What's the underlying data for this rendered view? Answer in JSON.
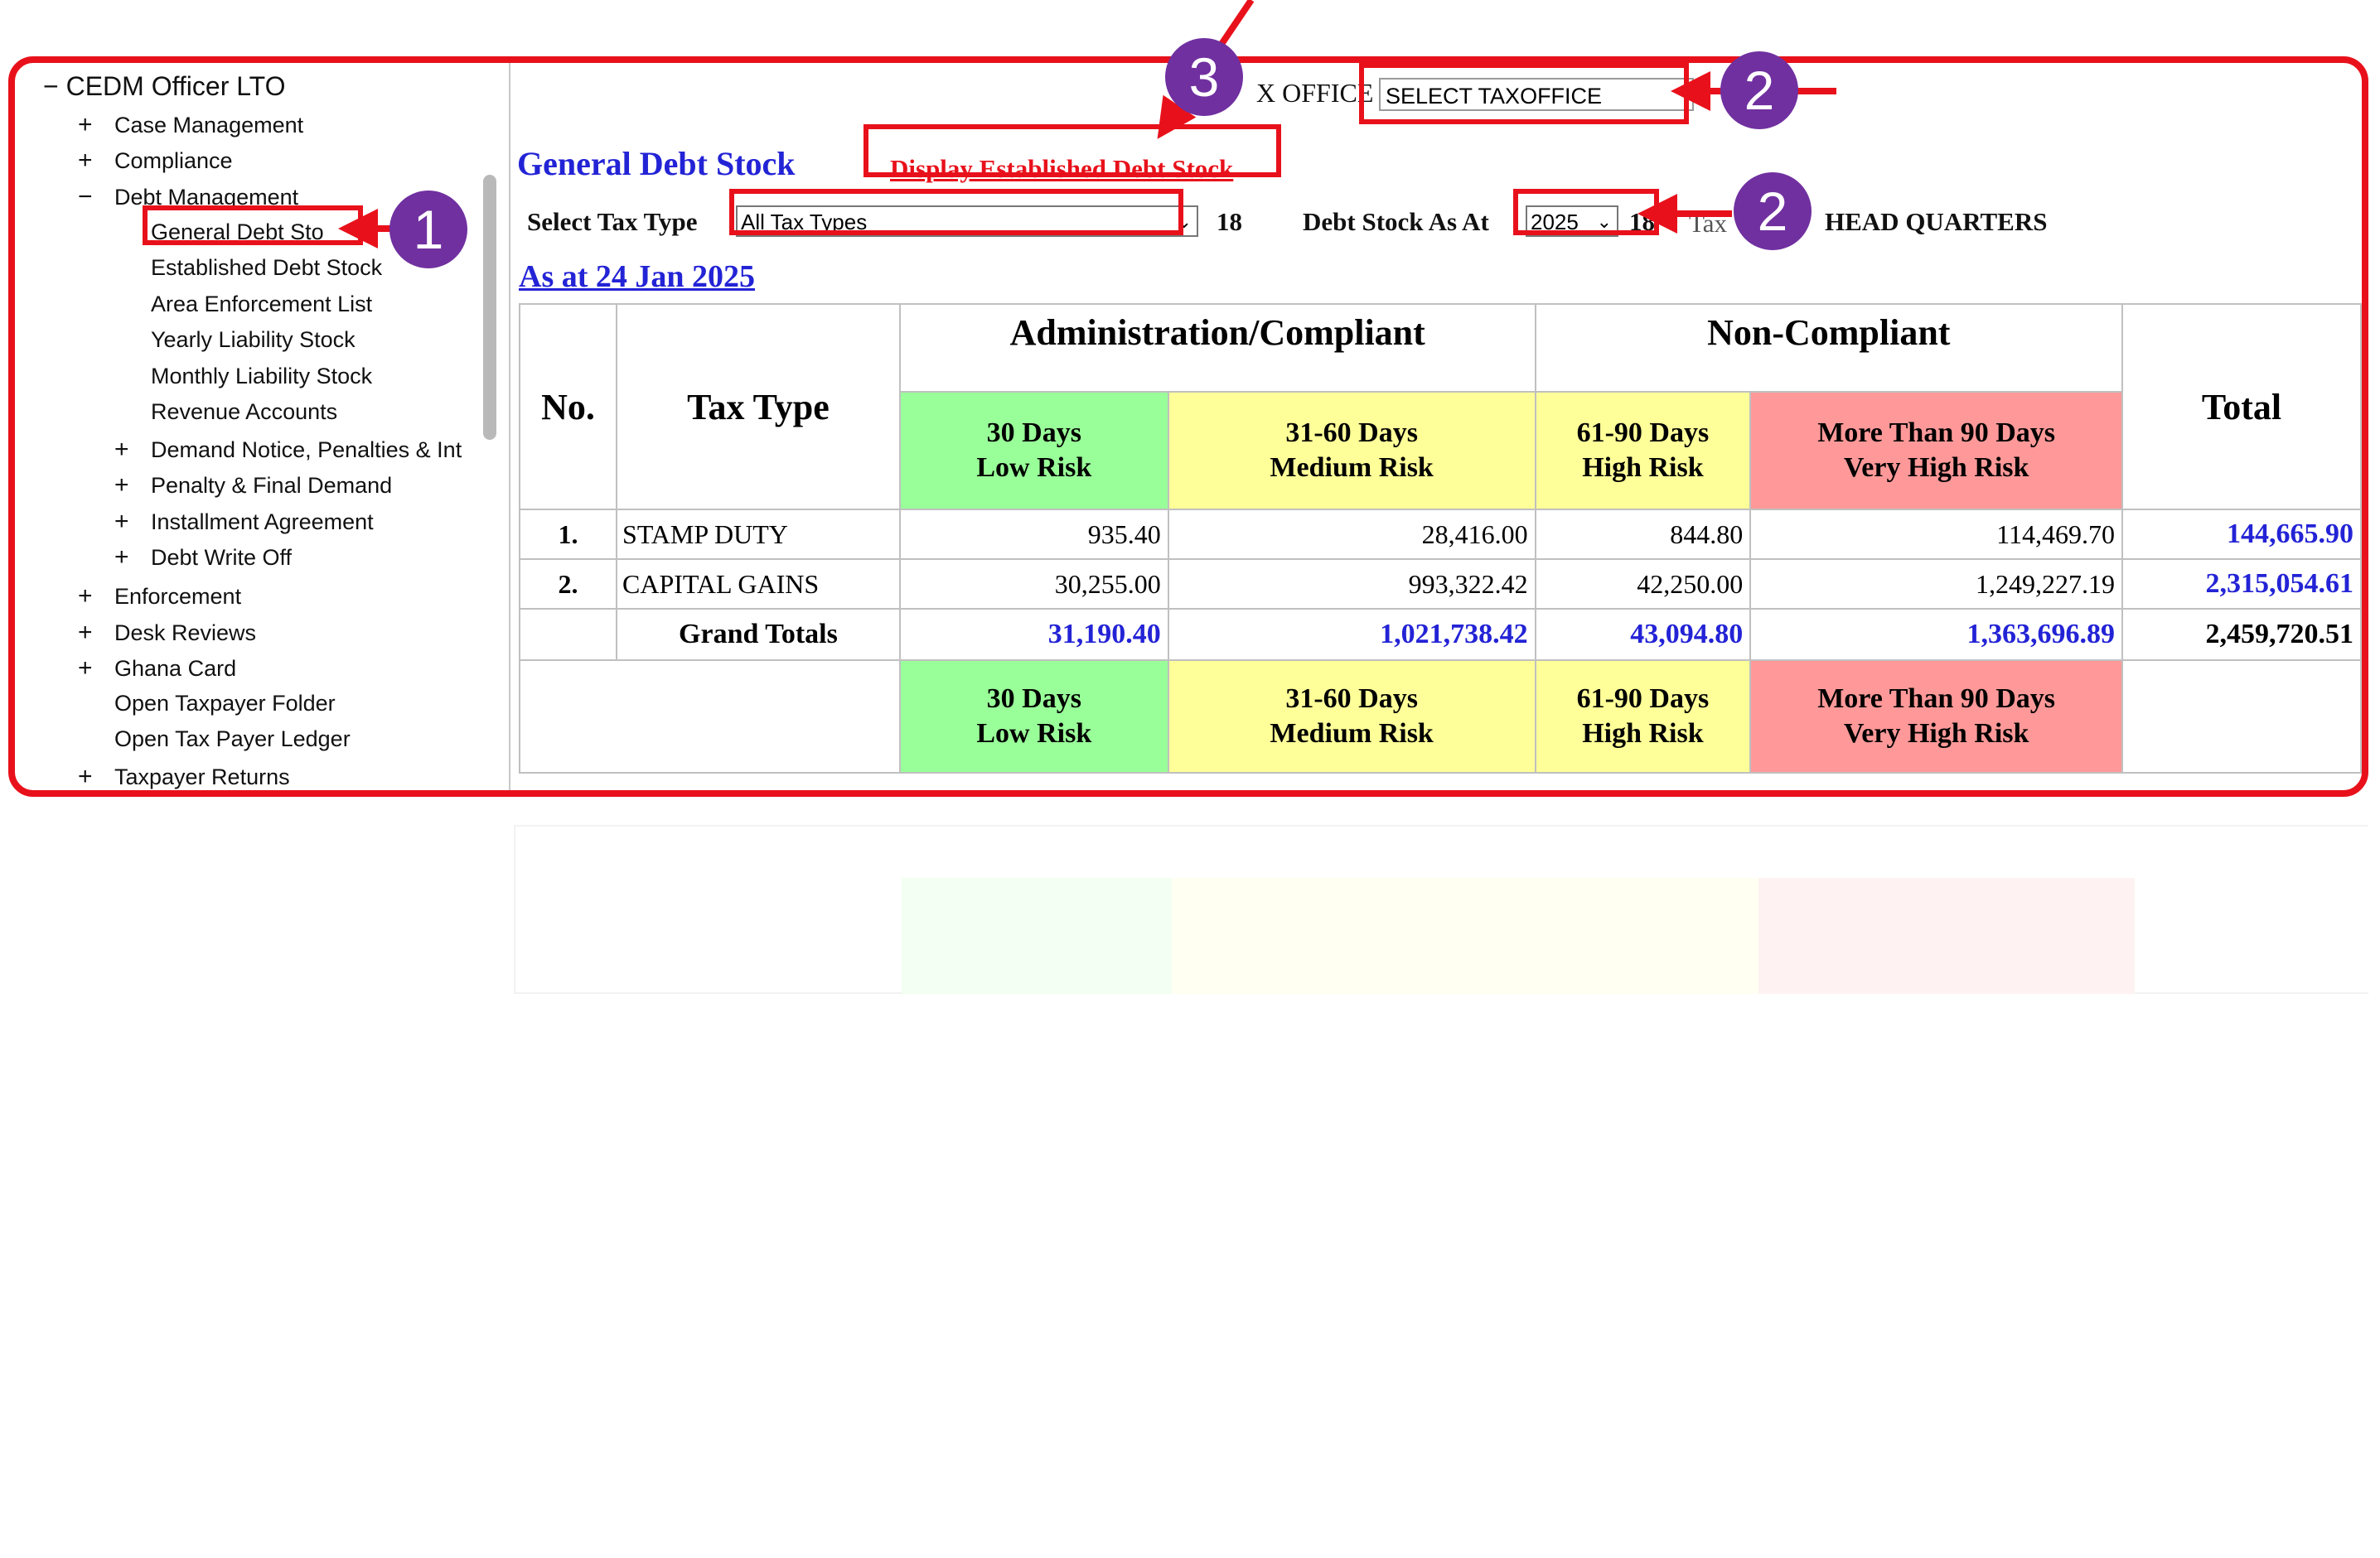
{
  "sidebar": {
    "root": {
      "toggle": "−",
      "label": "CEDM Officer LTO"
    },
    "items": [
      {
        "toggle": "+",
        "label": "Case Management"
      },
      {
        "toggle": "+",
        "label": "Compliance"
      },
      {
        "toggle": "−",
        "label": "Debt Management"
      },
      {
        "toggle": "",
        "label": "General Debt Sto"
      },
      {
        "toggle": "",
        "label": "Established Debt Stock"
      },
      {
        "toggle": "",
        "label": "Area Enforcement List"
      },
      {
        "toggle": "",
        "label": "Yearly Liability Stock"
      },
      {
        "toggle": "",
        "label": "Monthly Liability Stock"
      },
      {
        "toggle": "",
        "label": "Revenue Accounts"
      },
      {
        "toggle": "+",
        "label": "Demand Notice, Penalties & Int"
      },
      {
        "toggle": "+",
        "label": "Penalty & Final Demand"
      },
      {
        "toggle": "+",
        "label": "Installment Agreement"
      },
      {
        "toggle": "+",
        "label": "Debt Write Off"
      },
      {
        "toggle": "+",
        "label": "Enforcement"
      },
      {
        "toggle": "+",
        "label": "Desk Reviews"
      },
      {
        "toggle": "+",
        "label": "Ghana Card"
      },
      {
        "toggle": "",
        "label": "Open Taxpayer Folder"
      },
      {
        "toggle": "",
        "label": "Open Tax Payer Ledger"
      },
      {
        "toggle": "+",
        "label": "Taxpayer Returns"
      }
    ]
  },
  "header": {
    "tax_office_label": "X OFFICE",
    "tax_office_value": "SELECT TAXOFFICE",
    "page_title": "General Debt Stock",
    "display_link": "Display Established Debt Stock"
  },
  "filters": {
    "tax_type_label": "Select Tax Type",
    "tax_type_value": "All Tax Types",
    "tax_type_count": "18",
    "debt_stock_label": "Debt Stock As At",
    "debt_stock_year": "2025",
    "debt_stock_count": "18",
    "tax_label": "Tax",
    "office_name": "HEAD QUARTERS"
  },
  "as_at": "As at 24 Jan 2025",
  "table": {
    "col_no": "No.",
    "col_tax_type": "Tax Type",
    "group_admin": "Administration/Compliant",
    "group_noncompliant": "Non-Compliant",
    "col_total": "Total",
    "bands": [
      {
        "line1": "30 Days",
        "line2": "Low Risk"
      },
      {
        "line1": "31-60 Days",
        "line2": "Medium Risk"
      },
      {
        "line1": "61-90 Days",
        "line2": "High Risk"
      },
      {
        "line1": "More Than 90 Days",
        "line2": "Very High Risk"
      }
    ],
    "rows": [
      {
        "no": "1.",
        "tax_type": "STAMP DUTY",
        "d30": "935.40",
        "d60": "28,416.00",
        "d90": "844.80",
        "d90plus": "114,469.70",
        "total": "144,665.90"
      },
      {
        "no": "2.",
        "tax_type": "CAPITAL GAINS",
        "d30": "30,255.00",
        "d60": "993,322.42",
        "d90": "42,250.00",
        "d90plus": "1,249,227.19",
        "total": "2,315,054.61"
      }
    ],
    "grand": {
      "label": "Grand Totals",
      "d30": "31,190.40",
      "d60": "1,021,738.42",
      "d90": "43,094.80",
      "d90plus": "1,363,696.89",
      "total": "2,459,720.51"
    }
  },
  "annotations": {
    "badge1": "1",
    "badge2a": "2",
    "badge2b": "2",
    "badge3": "3",
    "annotation_color": "#e8111b",
    "badge_color": "#7030a0"
  },
  "colors": {
    "low_risk": "#99ff99",
    "medium_risk": "#ffff99",
    "high_risk": "#ffff99",
    "very_high_risk": "#ff9999",
    "link_blue": "#2323d6"
  }
}
